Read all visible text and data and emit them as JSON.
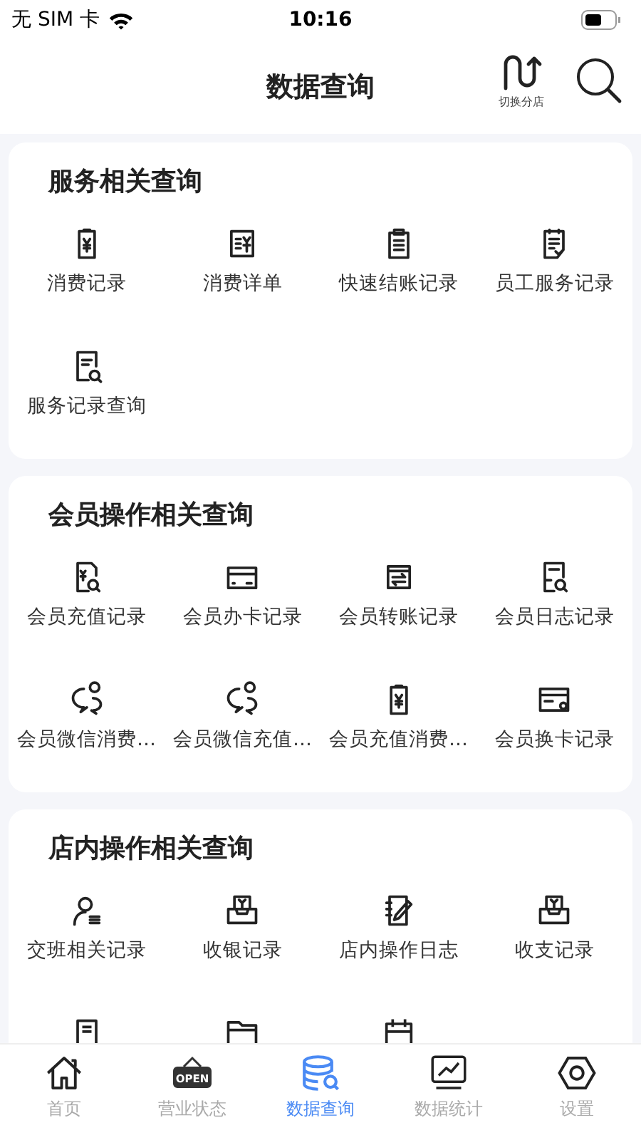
{
  "status_bar": {
    "carrier": "无 SIM 卡",
    "time": "10:16"
  },
  "header": {
    "title": "数据查询",
    "switch_label": "切换分店"
  },
  "sections": [
    {
      "title": "服务相关查询",
      "items": [
        {
          "kind": "full",
          "label": "消费记录"
        },
        {
          "kind": "full",
          "label": "消费详单"
        },
        {
          "kind": "full",
          "label": "快速结账记录"
        },
        {
          "kind": "full",
          "label": "员工服务记录"
        },
        {
          "kind": "full",
          "label": "服务记录查询"
        }
      ]
    },
    {
      "title": "会员操作相关查询",
      "items": [
        {
          "kind": "full",
          "label": "会员充值记录"
        },
        {
          "kind": "full",
          "label": "会员办卡记录"
        },
        {
          "kind": "full",
          "label": "会员转账记录"
        },
        {
          "kind": "full",
          "label": "会员日志记录"
        },
        {
          "kind": "full",
          "label": "会员微信消费…"
        },
        {
          "kind": "full",
          "label": "会员微信充值…"
        },
        {
          "kind": "full",
          "label": "会员充值消费…"
        },
        {
          "kind": "full",
          "label": "会员换卡记录"
        }
      ]
    },
    {
      "title": "店内操作相关查询",
      "items": [
        {
          "kind": "full",
          "label": "交班相关记录"
        },
        {
          "kind": "full",
          "label": "收银记录"
        },
        {
          "kind": "full",
          "label": "店内操作日志"
        },
        {
          "kind": "full",
          "label": "收支记录"
        },
        {
          "kind": "cut"
        },
        {
          "kind": "cut"
        },
        {
          "kind": "cut"
        }
      ]
    }
  ],
  "tab_bar": [
    {
      "label": "首页",
      "selected": false
    },
    {
      "label": "营业状态",
      "selected": false,
      "sign_text": "OPEN"
    },
    {
      "label": "数据查询",
      "selected": true
    },
    {
      "label": "数据统计",
      "selected": false
    },
    {
      "label": "设置",
      "selected": false
    }
  ]
}
